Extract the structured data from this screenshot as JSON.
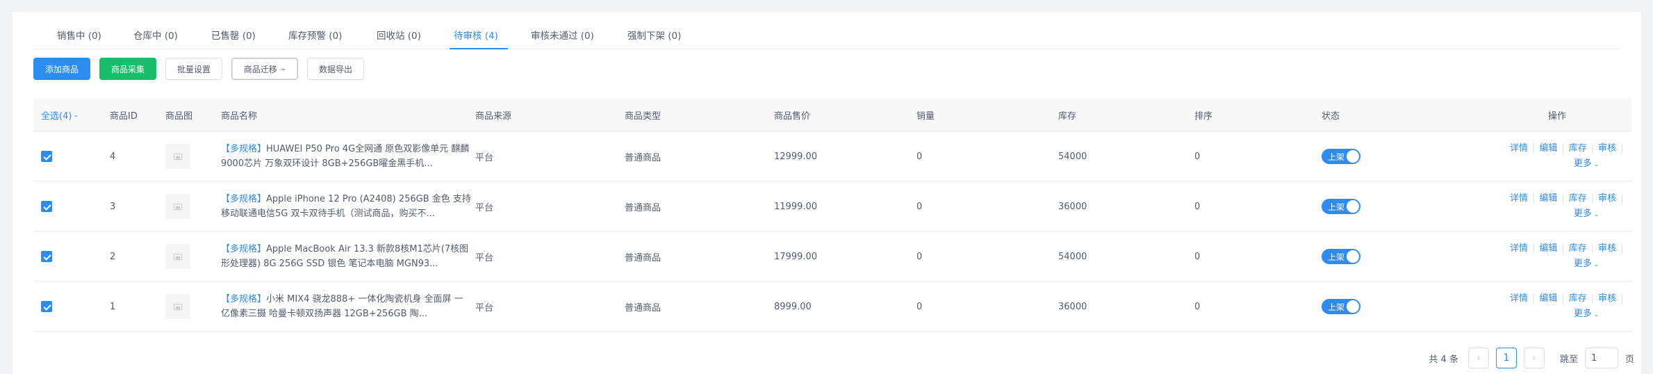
{
  "tabs": [
    {
      "label": "销售中 (0)",
      "active": false
    },
    {
      "label": "仓库中 (0)",
      "active": false
    },
    {
      "label": "已售罄 (0)",
      "active": false
    },
    {
      "label": "库存预警 (0)",
      "active": false
    },
    {
      "label": "回收站 (0)",
      "active": false
    },
    {
      "label": "待审核 (4)",
      "active": true
    },
    {
      "label": "审核未通过 (0)",
      "active": false
    },
    {
      "label": "强制下架 (0)",
      "active": false
    }
  ],
  "toolbar": {
    "add_label": "添加商品",
    "collect_label": "商品采集",
    "batch_label": "批量设置",
    "migrate_label": "商品迁移",
    "export_label": "数据导出"
  },
  "table": {
    "select_all": "全选(4)",
    "headers": {
      "id": "商品ID",
      "image": "商品图",
      "name": "商品名称",
      "source": "商品来源",
      "type": "商品类型",
      "price": "商品售价",
      "sales": "销量",
      "stock": "库存",
      "sort": "排序",
      "status": "状态",
      "ops": "操作"
    },
    "rows": [
      {
        "id": "4",
        "tag": "【多规格】",
        "name": "HUAWEI P50 Pro 4G全网通 原色双影像单元 麒麟9000芯片 万象双环设计 8GB+256GB曜金黑手机...",
        "source": "平台",
        "type": "普通商品",
        "price": "12999.00",
        "sales": "0",
        "stock": "54000",
        "sort": "0",
        "status": "上架"
      },
      {
        "id": "3",
        "tag": "【多规格】",
        "name": "Apple iPhone 12 Pro (A2408) 256GB 金色 支持移动联通电信5G 双卡双待手机（测试商品，购买不...",
        "source": "平台",
        "type": "普通商品",
        "price": "11999.00",
        "sales": "0",
        "stock": "36000",
        "sort": "0",
        "status": "上架"
      },
      {
        "id": "2",
        "tag": "【多规格】",
        "name": "Apple MacBook Air 13.3 新款8核M1芯片(7核图形处理器) 8G 256G SSD 银色 笔记本电脑 MGN93...",
        "source": "平台",
        "type": "普通商品",
        "price": "17999.00",
        "sales": "0",
        "stock": "54000",
        "sort": "0",
        "status": "上架"
      },
      {
        "id": "1",
        "tag": "【多规格】",
        "name": "小米 MIX4 骁龙888+ 一体化陶瓷机身 全面屏 一亿像素三摄 哈曼卡顿双扬声器 12GB+256GB 陶...",
        "source": "平台",
        "type": "普通商品",
        "price": "8999.00",
        "sales": "0",
        "stock": "36000",
        "sort": "0",
        "status": "上架"
      }
    ],
    "ops": {
      "detail": "详情",
      "edit": "编辑",
      "stock": "库存",
      "audit": "审核",
      "more": "更多"
    }
  },
  "pagination": {
    "total": "共 4 条",
    "current": "1",
    "jump_label": "跳至",
    "jump_value": "1",
    "page_unit": "页"
  },
  "colors": {
    "primary": "#2d8cf0",
    "success": "#19be6b",
    "background": "#f0f2f5"
  }
}
